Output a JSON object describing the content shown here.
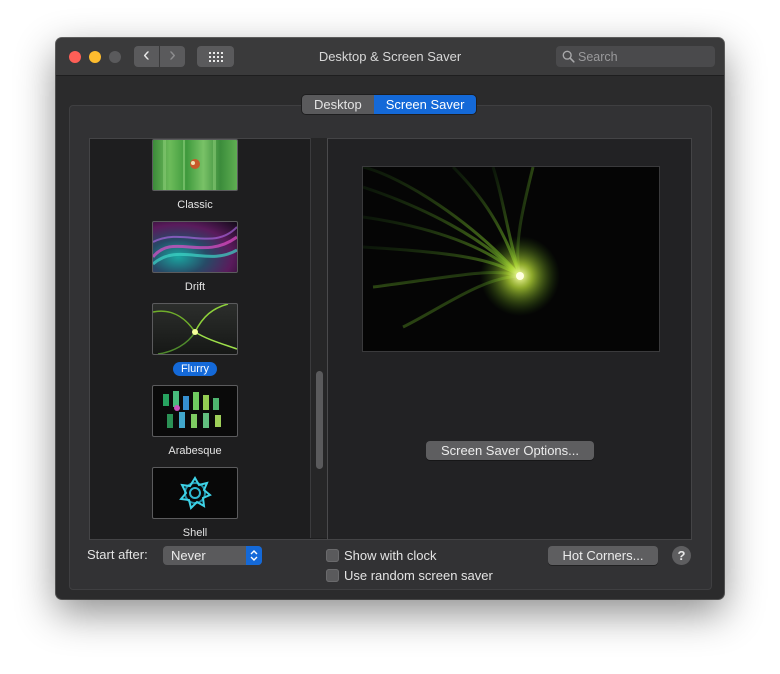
{
  "window": {
    "title": "Desktop & Screen Saver",
    "nav_back_glyph": "‹",
    "nav_forward_glyph": "›"
  },
  "search": {
    "placeholder": "Search",
    "icon": "magnifier-icon"
  },
  "tabs": [
    {
      "label": "Desktop",
      "active": false
    },
    {
      "label": "Screen Saver",
      "active": true
    }
  ],
  "screen_savers": [
    {
      "label": "Classic",
      "selected": false
    },
    {
      "label": "Drift",
      "selected": false
    },
    {
      "label": "Flurry",
      "selected": true
    },
    {
      "label": "Arabesque",
      "selected": false
    },
    {
      "label": "Shell",
      "selected": false
    }
  ],
  "preview": {
    "options_button": "Screen Saver Options..."
  },
  "bottom": {
    "start_after_label": "Start after:",
    "start_after_value": "Never",
    "show_with_clock": {
      "label": "Show with clock",
      "checked": false
    },
    "use_random": {
      "label": "Use random screen saver",
      "checked": false
    },
    "hot_corners_button": "Hot Corners...",
    "help_glyph": "?"
  },
  "colors": {
    "accent": "#1469d8",
    "window_bg": "#2b2b2c",
    "close": "#fe5f57",
    "minimize": "#febc2e"
  }
}
